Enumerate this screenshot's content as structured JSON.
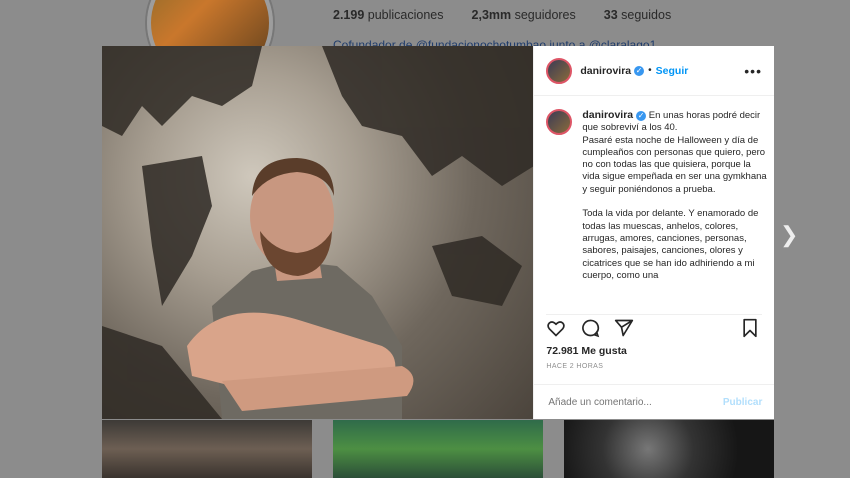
{
  "profile": {
    "stats": [
      {
        "value": "2.199",
        "label": "publicaciones"
      },
      {
        "value": "2,3mm",
        "label": "seguidores"
      },
      {
        "value": "33",
        "label": "seguidos"
      }
    ],
    "bio": "Cofundador de @fundacionochotumbao junto a @claralago1"
  },
  "post": {
    "header": {
      "username": "danirovira",
      "separator": "•",
      "follow_label": "Seguir",
      "more_icon": "more-dots-icon"
    },
    "caption": {
      "username": "danirovira",
      "text": "En unas horas podré decir que sobreviví a los 40.\nPasaré esta noche de Halloween y día de cumpleaños con personas que quiero, pero no con todas las que quisiera, porque la vida sigue empeñada en ser una gymkhana y seguir poniéndonos a prueba.\n\nToda la vida por delante. Y enamorado de todas las muescas, anhelos, colores, arrugas, amores, canciones, personas, sabores, paisajes, canciones, olores y cicatrices que se han ido adhiriendo a mi cuerpo, como una"
    },
    "likes": "72.981 Me gusta",
    "time": "HACE 2 HORAS",
    "comment": {
      "placeholder": "Añade un comentario...",
      "publish_label": "Publicar"
    }
  },
  "colors": {
    "accent": "#0095f6",
    "verified": "#3897f0",
    "overlay": "#8c8c8c"
  }
}
